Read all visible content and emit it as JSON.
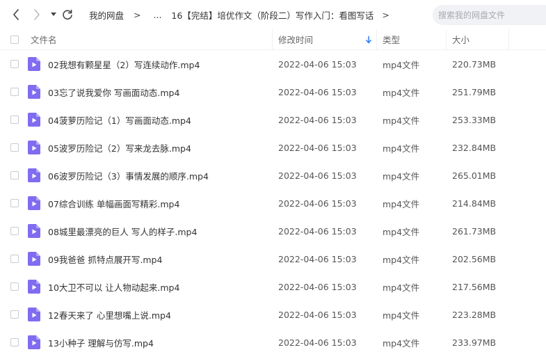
{
  "colors": {
    "accent": "#2f7cf6",
    "file_icon": "#7f6cf0",
    "search_bg": "#f1f2f5"
  },
  "toolbar": {
    "back_icon": "chevron-left-icon",
    "forward_icon": "chevron-right-icon",
    "history_icon": "caret-down-icon",
    "refresh_icon": "refresh-icon",
    "breadcrumb": {
      "root": "我的网盘",
      "separator": ">",
      "ellipsis": "...",
      "current": "16【完结】培优作文（阶段二）写作入门：看图写话"
    },
    "search_placeholder": "搜索我的网盘文件"
  },
  "table": {
    "columns": {
      "name": "文件名",
      "modified": "修改时间",
      "type": "类型",
      "size": "大小"
    },
    "sort_icon": "sort-down-icon",
    "rows": [
      {
        "name": "02我想有颗星星（2）写连续动作.mp4",
        "modified": "2022-04-06 15:03",
        "type": "mp4文件",
        "size": "220.73MB"
      },
      {
        "name": "03忘了说我爱你 写画面动态.mp4",
        "modified": "2022-04-06 15:03",
        "type": "mp4文件",
        "size": "251.79MB"
      },
      {
        "name": "04菠萝历险记（1）写画面动态.mp4",
        "modified": "2022-04-06 15:03",
        "type": "mp4文件",
        "size": "253.33MB"
      },
      {
        "name": "05波罗历险记（2）写来龙去脉.mp4",
        "modified": "2022-04-06 15:03",
        "type": "mp4文件",
        "size": "232.84MB"
      },
      {
        "name": "06波罗历险记（3）事情发展的顺序.mp4",
        "modified": "2022-04-06 15:03",
        "type": "mp4文件",
        "size": "265.01MB"
      },
      {
        "name": "07综合训练 单幅画面写精彩.mp4",
        "modified": "2022-04-06 15:03",
        "type": "mp4文件",
        "size": "214.84MB"
      },
      {
        "name": "08城里最漂亮的巨人  写人的样子.mp4",
        "modified": "2022-04-06 15:03",
        "type": "mp4文件",
        "size": "261.73MB"
      },
      {
        "name": "09我爸爸 抓特点展开写.mp4",
        "modified": "2022-04-06 15:03",
        "type": "mp4文件",
        "size": "202.56MB"
      },
      {
        "name": "10大卫不可以 让人物动起来.mp4",
        "modified": "2022-04-06 15:03",
        "type": "mp4文件",
        "size": "217.56MB"
      },
      {
        "name": "12春天来了 心里想嘴上说.mp4",
        "modified": "2022-04-06 15:03",
        "type": "mp4文件",
        "size": "223.28MB"
      },
      {
        "name": "13小种子 理解与仿写.mp4",
        "modified": "2022-04-06 15:03",
        "type": "mp4文件",
        "size": "233.97MB"
      }
    ]
  }
}
